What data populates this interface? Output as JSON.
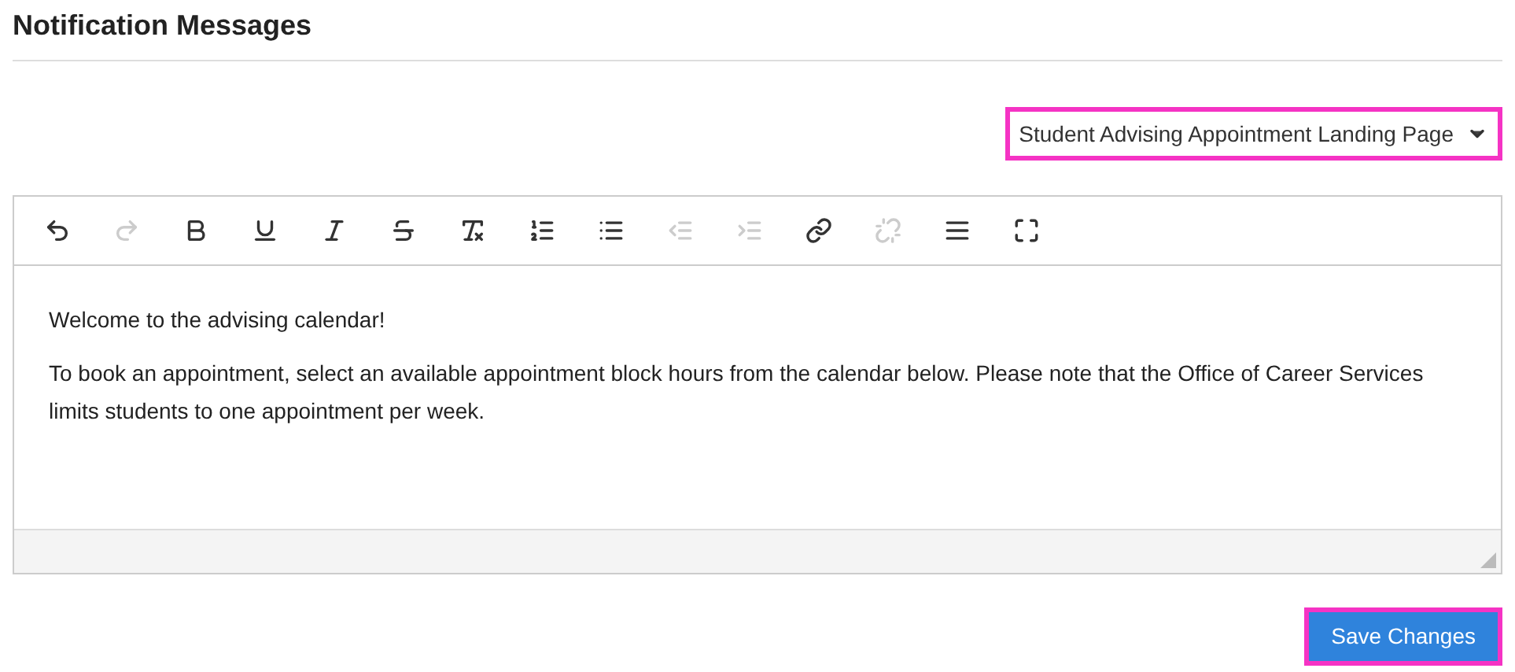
{
  "title": "Notification Messages",
  "dropdown": {
    "value": "Student Advising Appointment Landing Page",
    "highlighted": true
  },
  "toolbar": [
    {
      "kind": "undo",
      "disabled": false
    },
    {
      "kind": "redo",
      "disabled": true
    },
    {
      "kind": "bold",
      "disabled": false
    },
    {
      "kind": "underline",
      "disabled": false
    },
    {
      "kind": "italic",
      "disabled": false
    },
    {
      "kind": "strikethrough",
      "disabled": false
    },
    {
      "kind": "clearformat",
      "disabled": false
    },
    {
      "kind": "numbered",
      "disabled": false
    },
    {
      "kind": "bulleted",
      "disabled": false
    },
    {
      "kind": "outdent",
      "disabled": true
    },
    {
      "kind": "indent",
      "disabled": true
    },
    {
      "kind": "link",
      "disabled": false
    },
    {
      "kind": "unlink",
      "disabled": true
    },
    {
      "kind": "rule",
      "disabled": false
    },
    {
      "kind": "fullscreen",
      "disabled": false
    }
  ],
  "editor": {
    "paragraphs": [
      "Welcome to the advising calendar!",
      "To book an appointment, select an available appointment block hours from the calendar below. Please note that the Office of Career Services limits students to one appointment per week."
    ]
  },
  "save_button": {
    "label": "Save Changes",
    "highlighted": true
  }
}
